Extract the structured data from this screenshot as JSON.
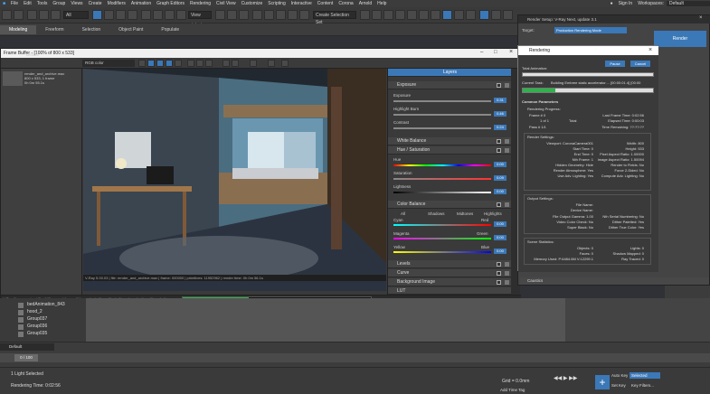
{
  "menubar": {
    "items": [
      "File",
      "Edit",
      "Tools",
      "Group",
      "Views",
      "Create",
      "Modifiers",
      "Animation",
      "Graph Editors",
      "Rendering",
      "Civil View",
      "Customize",
      "Scripting",
      "Interactive",
      "Content",
      "Corona",
      "Arnold",
      "Help"
    ],
    "signin": "Sign In",
    "workspaces_label": "Workspaces:",
    "workspace_value": "Default"
  },
  "toolbar": {
    "view_select": "View",
    "selection_set": "Create Selection Set",
    "interior": "interior"
  },
  "ribbon": {
    "tabs": [
      "Modeling",
      "Freeform",
      "Selection",
      "Object Paint",
      "Populate"
    ],
    "active": "Modeling"
  },
  "vfb": {
    "title": "Frame Buffer - [100% of 800 x 533]",
    "channel": "RGB color",
    "thumb_label": "render_and_archive.max",
    "thumb_info": "800 x 533, 1 frame",
    "thumb_time": "0h 0m 55.1s",
    "details": "Details",
    "status_line": "V-Ray 5.00.03 | file: render_and_archive.max | frame: 000000 | primitives: 11952962 | render time: 0h 0m 56.1s",
    "progress_text": "Building Embree static accelerator.... [00:00:01.4] [00:00:03.9 est]",
    "progress_left": "V-Ray %vrayversion | file: %filename | frame: %frame | primitives: %primitives | render time: %rendertime",
    "progress_pct": 0.35
  },
  "color_correction": {
    "tab_label": "Layers",
    "exposure": {
      "title": "Exposure",
      "exposure_label": "Exposure",
      "exposure_val": "0.31",
      "highlight_label": "Highlight Burn",
      "highlight_val": "0.46",
      "contrast_label": "Contrast",
      "contrast_val": "0.24"
    },
    "white_balance": "White Balance",
    "hue_sat": {
      "title": "Hue / Saturation",
      "hue_label": "Hue",
      "hue_val": "0.00",
      "sat_label": "Saturation",
      "sat_val": "0.09",
      "light_label": "Lightness",
      "light_val": "0.00"
    },
    "color_balance": {
      "title": "Color Balance",
      "all": "All",
      "shadows": "Shadows",
      "midtones": "Midtones",
      "highlights": "Highlights",
      "cyan": "Cyan",
      "red": "Red",
      "magenta": "Magenta",
      "green": "Green",
      "yellow": "Yellow",
      "blue": "Blue",
      "v1": "0.00",
      "v2": "0.00",
      "v3": "0.00"
    },
    "levels": "Levels",
    "curve": "Curve",
    "background_image": "Background Image",
    "lut": "LUT"
  },
  "render_setup": {
    "title": "Render Setup: V-Ray Next, update 3.1",
    "target_label": "Target:",
    "target_value": "Production Rendering Mode",
    "render_button": "Render",
    "caustics": "Caustics"
  },
  "rendering_dialog": {
    "title": "Rendering",
    "pause": "Pause",
    "cancel": "Cancel",
    "total_animation": "Total Animation:",
    "current_task_label": "Current Task:",
    "current_task": "Building Embree static accelerator.... [00:00:01.4] [00:00",
    "current_pct": 0.25,
    "common_params": "Common Parameters",
    "rendering_progress": "Rendering Progress:",
    "frame_num": "Frame #  0",
    "last_frame_time": "Last Frame Time:  0:02:56",
    "one_of_1": "1 of 1",
    "total": "Total",
    "elapsed_time": "Elapsed Time:  0:00:03",
    "passes": "Pass #  1/1",
    "time_remaining": "Time Remaining:  ??:??:??",
    "render_settings": "Render Settings:",
    "viewport": "Viewport:  CoronaCamera001",
    "width": "Width:  800",
    "start_time": "Start Time:  0",
    "height": "Height:  533",
    "end_time": "End Time:  0",
    "pixel_aspect": "Pixel Aspect Ratio:  1.00000",
    "nth_frame": "Nth Frame:  1",
    "image_aspect": "Image Aspect Ratio:  1.50094",
    "hidden_geometry": "Hidden Geometry:  Hide",
    "render_to_fields": "Render to Fields:  No",
    "render_atmos": "Render Atmosphere:  Yes",
    "force_2sided": "Force 2-Sided:  No",
    "use_adv_lighting": "Use Adv. Lighting:  Yes",
    "compute_adv_lighting": "Compute Adv. Lighting:  No",
    "output_settings": "Output Settings:",
    "file_name": "File Name:",
    "device_name": "Device Name:",
    "file_output_gamma": "File Output Gamma:  1.00",
    "nth_serial": "Nth Serial Numbering:  No",
    "video_color_check": "Video Color Check:  No",
    "dither_paletted": "Dither Paletted:  Yes",
    "super_black": "Super Black:  No",
    "dither_true_color": "Dither True Color:  Yes",
    "scene_stats": "Scene Statistics:",
    "objects": "Objects:  0",
    "lights": "Lights:  0",
    "faces": "Faces:  0",
    "shadow_mapped": "Shadow Mapped:  0",
    "memory_used": "Memory Used:  P:6484.6M V:12299.1",
    "ray_traced": "Ray Traced:  0"
  },
  "scene_explorer": {
    "rows": [
      "bedAnimation_843",
      "hood_2",
      "Group037",
      "Group036",
      "Group035"
    ],
    "layer": "Default"
  },
  "timeline": {
    "frame_field": "0 / 100"
  },
  "statusbar": {
    "selection": "1 Light Selected",
    "rendering_time": "Rendering Time:  0:02:56",
    "grid": "Grid = 0.0mm",
    "add_time_tag": "Add Time Tag",
    "auto_key": "Auto Key",
    "selected": "Selected",
    "set_key": "Set Key",
    "key_filters": "Key Filters..."
  }
}
